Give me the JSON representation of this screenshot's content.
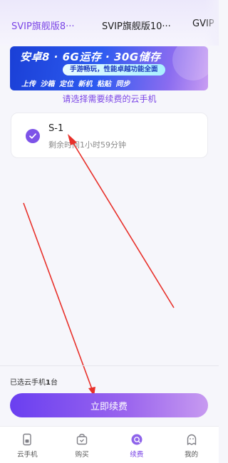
{
  "tabs": [
    {
      "label": "SVIP旗舰版8···",
      "active": true
    },
    {
      "label": "SVIP旗舰版10···",
      "active": false
    },
    {
      "label": "GVIP",
      "active": false
    }
  ],
  "banner": {
    "line1": "安卓8 · 6G运存 · 30G储存",
    "pill": "手游畅玩，性能卓越功能全面",
    "line3": "上传 沙箱 定位 新机 粘贴 同步"
  },
  "subtitle": "请选择需要续费的云手机",
  "phone": {
    "name": "S-1",
    "remaining": "剩余时间1小时59分钟",
    "checked": true
  },
  "footer": {
    "selected_prefix": "已选云手机",
    "selected_count": "1",
    "selected_suffix": "台",
    "renew_label": "立即续费"
  },
  "nav": [
    {
      "label": "云手机",
      "icon": "cloud-phone-icon"
    },
    {
      "label": "购买",
      "icon": "shopping-bag-icon"
    },
    {
      "label": "续费",
      "icon": "renew-icon",
      "active": true
    },
    {
      "label": "我的",
      "icon": "profile-ghost-icon"
    }
  ],
  "colors": {
    "accent": "#7a44e6",
    "annotation_arrow": "#e8302a"
  }
}
